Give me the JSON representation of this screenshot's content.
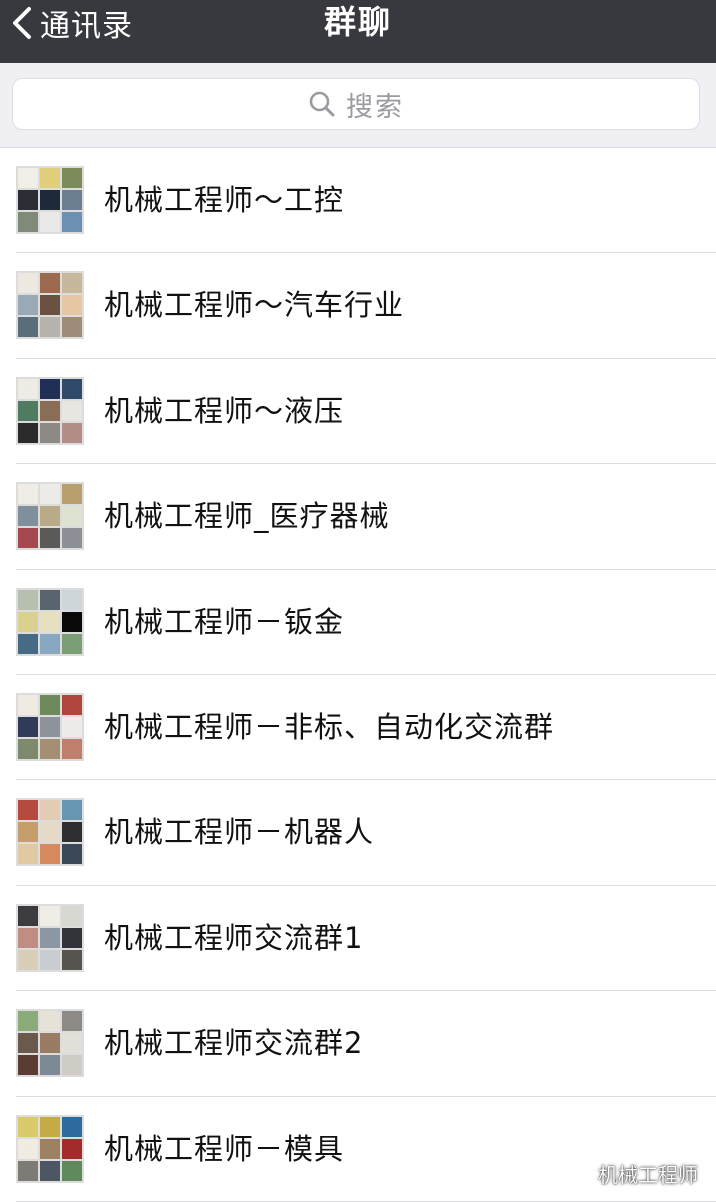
{
  "navbar": {
    "back_label": "通讯录",
    "title": "群聊",
    "background": "#37393e"
  },
  "search": {
    "placeholder": "搜索",
    "icon": "search-icon"
  },
  "groups": [
    {
      "name": "机械工程师～工控",
      "avatar_colors": [
        "#f1efe8",
        "#e0cf7a",
        "#7d8a59",
        "#2b2e35",
        "#1d2a3a",
        "#6b7e92",
        "#7f8a78",
        "#e8e8e6",
        "#6c8fb3"
      ]
    },
    {
      "name": "机械工程师～汽车行业",
      "avatar_colors": [
        "#ede9e1",
        "#9c6b4f",
        "#c7b79b",
        "#9aa9b6",
        "#6b5140",
        "#e7c7a2",
        "#5a6d7b",
        "#b6b3ad",
        "#9e8c78"
      ]
    },
    {
      "name": "机械工程师～液压",
      "avatar_colors": [
        "#efece6",
        "#1f2f55",
        "#314a6a",
        "#4f7b60",
        "#8a6d55",
        "#e8e6e0",
        "#2a2a2a",
        "#8d8a86",
        "#b38e88"
      ]
    },
    {
      "name": "机械工程师_医疗器械",
      "avatar_colors": [
        "#f0ede6",
        "#ecebe7",
        "#b7a06e",
        "#7f8f9c",
        "#b9aa88",
        "#dce3d0",
        "#a3494f",
        "#5c5a58",
        "#8d8f96"
      ]
    },
    {
      "name": "机械工程师－钣金",
      "avatar_colors": [
        "#b7c0b0",
        "#59656e",
        "#cfd6da",
        "#d9cf8e",
        "#e6e0c0",
        "#0a0a0a",
        "#476b84",
        "#88a8c2",
        "#7a9f76"
      ]
    },
    {
      "name": "机械工程师－非标、自动化交流群",
      "avatar_colors": [
        "#efebe3",
        "#6e8a5c",
        "#b0453e",
        "#2f3b58",
        "#8e939b",
        "#eeece8",
        "#7d8a6b",
        "#a58f74",
        "#c07e6c"
      ]
    },
    {
      "name": "机械工程师－机器人",
      "avatar_colors": [
        "#b64a3f",
        "#e2cdb4",
        "#6797b3",
        "#c59e6b",
        "#e5d9c7",
        "#2f2f33",
        "#e0c8a0",
        "#d6895e",
        "#3b4857"
      ]
    },
    {
      "name": "机械工程师交流群1",
      "avatar_colors": [
        "#3c3c40",
        "#f0ede6",
        "#d8d8d2",
        "#c08d83",
        "#8b97a3",
        "#31353a",
        "#d9cfb9",
        "#c9ccd0",
        "#57534f"
      ]
    },
    {
      "name": "机械工程师交流群2",
      "avatar_colors": [
        "#8cab7a",
        "#e6e2d8",
        "#8e8b86",
        "#6a5a4e",
        "#9a7b64",
        "#e2dfd9",
        "#5a3c34",
        "#7d8a96",
        "#cfcbc5"
      ]
    },
    {
      "name": "机械工程师－模具",
      "avatar_colors": [
        "#d9ca6a",
        "#c5ab45",
        "#2d6a9d",
        "#f0ece4",
        "#9c8062",
        "#a22b2b",
        "#7e7a75",
        "#4d5763",
        "#5f8a5c"
      ]
    }
  ],
  "watermark": {
    "text": "机械工程师",
    "icon": "wechat-official-icon"
  }
}
